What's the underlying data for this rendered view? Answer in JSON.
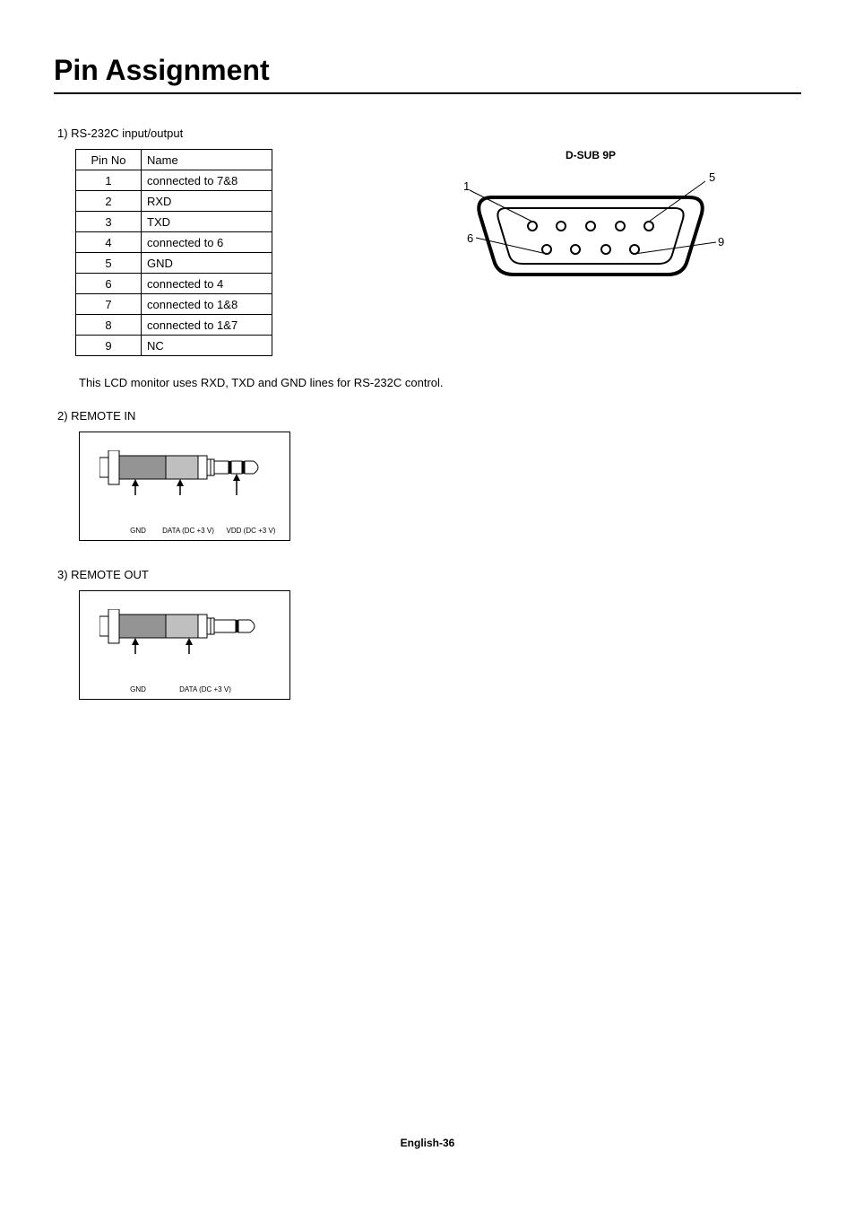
{
  "title": "Pin Assignment",
  "section1": {
    "label": "1)  RS-232C input/output",
    "table": {
      "headers": [
        "Pin No",
        "Name"
      ],
      "rows": [
        [
          "1",
          "connected to 7&8"
        ],
        [
          "2",
          "RXD"
        ],
        [
          "3",
          "TXD"
        ],
        [
          "4",
          "connected to 6"
        ],
        [
          "5",
          "GND"
        ],
        [
          "6",
          "connected to 4"
        ],
        [
          "7",
          "connected to 1&8"
        ],
        [
          "8",
          "connected to 1&7"
        ],
        [
          "9",
          "NC"
        ]
      ]
    },
    "connector": {
      "title": "D-SUB 9P",
      "labels": {
        "tl": "1",
        "tr": "5",
        "bl": "6",
        "br": "9"
      }
    },
    "note": "This LCD monitor uses RXD, TXD and GND lines for RS-232C control."
  },
  "section2": {
    "label": "2)  REMOTE IN",
    "pins": [
      {
        "name": "GND"
      },
      {
        "name": "DATA (DC +3 V)"
      },
      {
        "name": "VDD (DC +3 V)"
      }
    ]
  },
  "section3": {
    "label": "3)  REMOTE OUT",
    "pins": [
      {
        "name": "GND"
      },
      {
        "name": "DATA (DC +3 V)"
      }
    ]
  },
  "footer": "English-36"
}
